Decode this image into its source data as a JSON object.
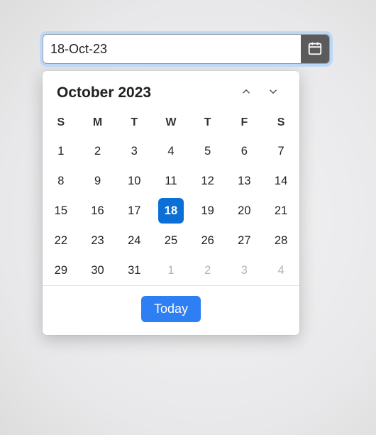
{
  "input": {
    "value": "18-Oct-23"
  },
  "calendar": {
    "title": "October 2023",
    "weekday_headers": [
      "S",
      "M",
      "T",
      "W",
      "T",
      "F",
      "S"
    ],
    "selected_day": 18,
    "days": [
      {
        "n": 1,
        "out": false
      },
      {
        "n": 2,
        "out": false
      },
      {
        "n": 3,
        "out": false
      },
      {
        "n": 4,
        "out": false
      },
      {
        "n": 5,
        "out": false
      },
      {
        "n": 6,
        "out": false
      },
      {
        "n": 7,
        "out": false
      },
      {
        "n": 8,
        "out": false
      },
      {
        "n": 9,
        "out": false
      },
      {
        "n": 10,
        "out": false
      },
      {
        "n": 11,
        "out": false
      },
      {
        "n": 12,
        "out": false
      },
      {
        "n": 13,
        "out": false
      },
      {
        "n": 14,
        "out": false
      },
      {
        "n": 15,
        "out": false
      },
      {
        "n": 16,
        "out": false
      },
      {
        "n": 17,
        "out": false
      },
      {
        "n": 18,
        "out": false
      },
      {
        "n": 19,
        "out": false
      },
      {
        "n": 20,
        "out": false
      },
      {
        "n": 21,
        "out": false
      },
      {
        "n": 22,
        "out": false
      },
      {
        "n": 23,
        "out": false
      },
      {
        "n": 24,
        "out": false
      },
      {
        "n": 25,
        "out": false
      },
      {
        "n": 26,
        "out": false
      },
      {
        "n": 27,
        "out": false
      },
      {
        "n": 28,
        "out": false
      },
      {
        "n": 29,
        "out": false
      },
      {
        "n": 30,
        "out": false
      },
      {
        "n": 31,
        "out": false
      },
      {
        "n": 1,
        "out": true
      },
      {
        "n": 2,
        "out": true
      },
      {
        "n": 3,
        "out": true
      },
      {
        "n": 4,
        "out": true
      }
    ],
    "today_label": "Today"
  }
}
